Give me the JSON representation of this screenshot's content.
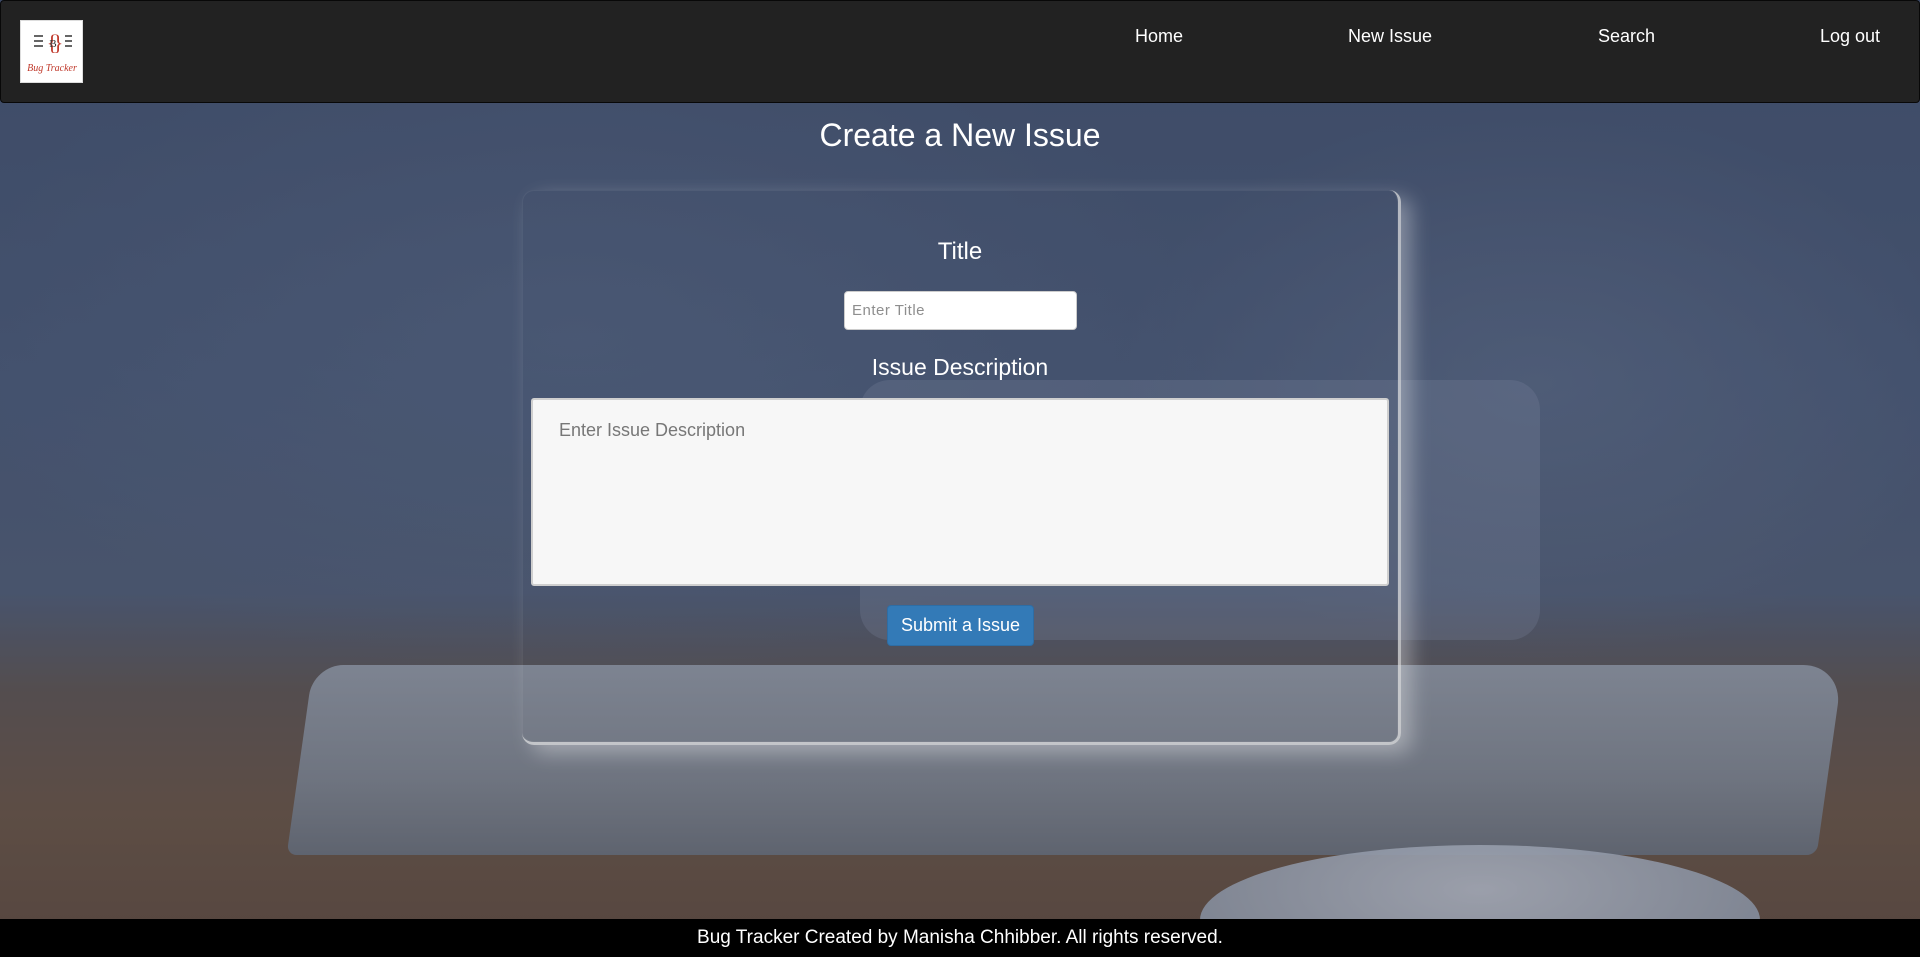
{
  "app": {
    "logo_alt": "Bug Tracker"
  },
  "nav": {
    "items": [
      {
        "label": "Home"
      },
      {
        "label": "New Issue"
      },
      {
        "label": "Search"
      },
      {
        "label": "Log out"
      }
    ]
  },
  "page": {
    "title": "Create a New Issue"
  },
  "form": {
    "title_label": "Title",
    "title_placeholder": "Enter Title",
    "title_value": "",
    "description_label": "Issue Description",
    "description_placeholder": "Enter Issue Description",
    "description_value": "",
    "submit_label": "Submit a Issue"
  },
  "footer": {
    "text": "Bug Tracker Created by Manisha Chhibber. All rights reserved."
  },
  "colors": {
    "navbar": "#222222",
    "primary_button": "#337ab7",
    "footer": "#000000",
    "logo_accent": "#c0392b"
  }
}
